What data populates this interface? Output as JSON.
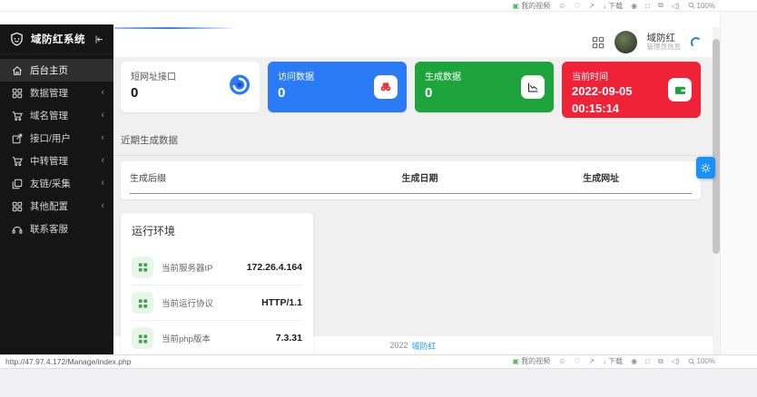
{
  "toolbar": {
    "video_label": "我的视频",
    "download_label": "下载",
    "zoom_level": "100%",
    "icons": {
      "video_glyph": "▣",
      "smiley_glyph": "☺",
      "heart_glyph": "♡",
      "send_glyph": "↗",
      "download_glyph": "↓",
      "record_glyph": "◉",
      "window_glyph": "□",
      "copy_glyph": "⧉",
      "speaker_glyph": "◁)"
    }
  },
  "status_bar": {
    "url": "http://47.97.4.172/Manage/index.php"
  },
  "sidebar": {
    "title": "域防红系统",
    "chevron": "‹",
    "items": [
      {
        "label": "后台主页"
      },
      {
        "label": "数据管理"
      },
      {
        "label": "域名管理"
      },
      {
        "label": "接口/用户"
      },
      {
        "label": "中转管理"
      },
      {
        "label": "友链/采集"
      },
      {
        "label": "其他配置"
      },
      {
        "label": "联系客服"
      }
    ]
  },
  "header": {
    "username": "域防红",
    "role": "管理员信息"
  },
  "cards": [
    {
      "label": "短网址接口",
      "value": "0"
    },
    {
      "label": "访问数据",
      "value": "0"
    },
    {
      "label": "生成数据",
      "value": "0"
    },
    {
      "label": "当前时间",
      "date": "2022-09-05",
      "time": "00:15:14"
    }
  ],
  "recent": {
    "title": "近期生成数据",
    "headers": [
      "生成后缀",
      "生成日期",
      "生成网址"
    ]
  },
  "environment": {
    "title": "运行环境",
    "rows": [
      {
        "label": "当前服务器IP",
        "value": "172.26.4.164"
      },
      {
        "label": "当前运行协议",
        "value": "HTTP/1.1"
      },
      {
        "label": "当前php版本",
        "value": "7.3.31"
      }
    ]
  },
  "footer": {
    "year": "2022",
    "brand": "域防红"
  },
  "colors": {
    "card_blue": "#2b7bf6",
    "card_green": "#1ea43c",
    "card_red": "#ef2238",
    "accent_blue": "#1890ff",
    "link_blue": "#1e9fff",
    "sidebar_bg": "#151515"
  }
}
